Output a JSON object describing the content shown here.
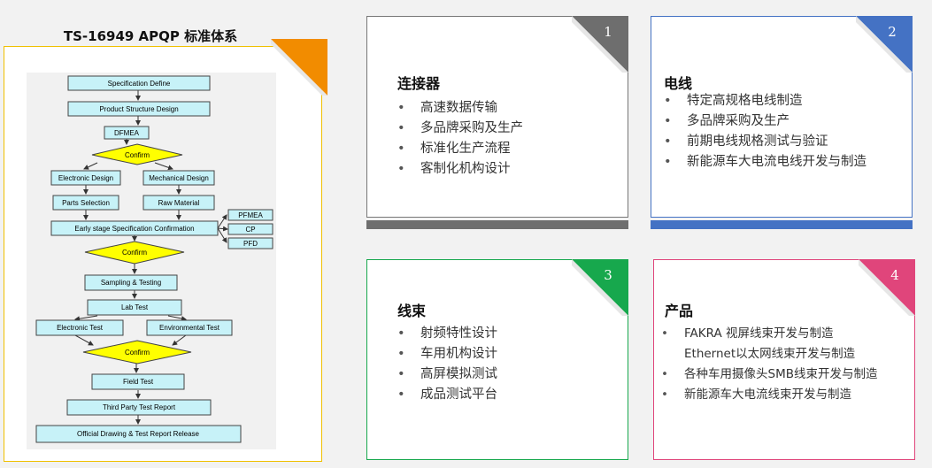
{
  "left": {
    "title": "TS-16949  APQP 标准体系",
    "flow": {
      "specification_define": "Specification Define",
      "product_structure_design": "Product Structure Design",
      "dfmea": "DFMEA",
      "confirm_1": "Confirm",
      "electronic_design": "Electronic Design",
      "mechanical_design": "Mechanical Design",
      "parts_selection": "Parts Selection",
      "raw_material": "Raw Material",
      "early_stage": "Early stage Specification Confirmation",
      "pfmea": "PFMEA",
      "cp": "CP",
      "pfd": "PFD",
      "confirm_2": "Confirm",
      "sampling_testing": "Sampling & Testing",
      "lab_test": "Lab Test",
      "electronic_test": "Electronic Test",
      "environmental_test": "Environmental Test",
      "confirm_3": "Confirm",
      "field_test": "Field Test",
      "third_party": "Third Party Test Report",
      "official_release": "Official Drawing & Test Report Release"
    }
  },
  "cards": [
    {
      "number": "1",
      "title": "连接器",
      "accent": "#6e6e6e",
      "items": [
        "高速数据传输",
        "多品牌采购及生产",
        "标准化生产流程",
        "客制化机构设计"
      ]
    },
    {
      "number": "2",
      "title": "电线",
      "accent": "#4472c4",
      "items": [
        "特定高规格电线制造",
        "多品牌采购及生产",
        "前期电线规格测试与验证",
        "新能源车大电流电线开发与制造"
      ]
    },
    {
      "number": "3",
      "title": "线束",
      "accent": "#17a84d",
      "items": [
        "射频特性设计",
        "车用机构设计",
        "高屏模拟测试",
        "成品测试平台"
      ]
    },
    {
      "number": "4",
      "title": "产品",
      "accent": "#e0457b",
      "items": [
        "FAKRA 视屏线束开发与制造",
        "Ethernet以太网线束开发与制造",
        "各种车用摄像头SMB线束开发与制造",
        "新能源车大电流线束开发与制造"
      ],
      "continuation_of_first": "Ethernet以太网线束开发与制造"
    }
  ],
  "colors": {
    "left_accent": "#f28c00",
    "flow_box": "#c7f2f8",
    "flow_diamond": "#ffff00"
  }
}
